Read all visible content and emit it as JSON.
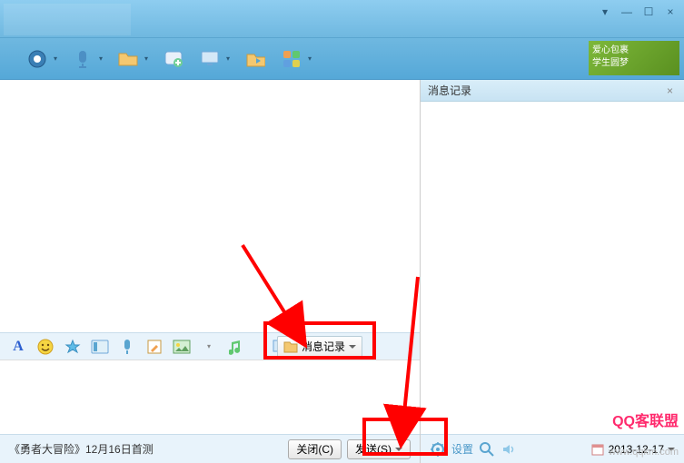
{
  "window": {
    "min": "—",
    "max": "☐",
    "close": "×"
  },
  "toolbar": {
    "promo_line1": "爱心包裹",
    "promo_line2": "学生圆梦"
  },
  "history_button": {
    "label": "消息记录"
  },
  "bottom": {
    "promo": "《勇者大冒险》12月16日首测",
    "close_btn": "关闭(C)",
    "send_btn": "发送(S)"
  },
  "right_pane": {
    "title": "消息记录",
    "close": "×",
    "settings_label": "设置",
    "date": "2013-12-17"
  },
  "watermark": {
    "main": "QQ客联盟",
    "sub": "www.qqkm.com"
  }
}
